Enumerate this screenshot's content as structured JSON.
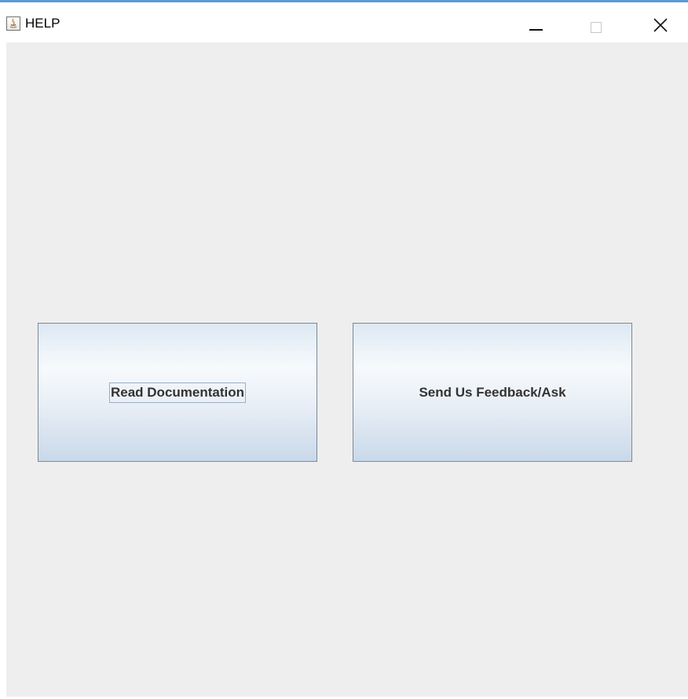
{
  "window": {
    "title": "HELP",
    "icon": "java-cup-icon",
    "controls": {
      "minimize": "minimize-icon",
      "maximize": "maximize-icon",
      "close": "close-icon"
    }
  },
  "buttons": {
    "read_documentation": "Read Documentation",
    "send_feedback": "Send Us Feedback/Ask"
  },
  "colors": {
    "accent_line": "#5b9bd5",
    "content_background": "#eeeeee",
    "button_border": "#7a8a99",
    "button_text": "#333333"
  }
}
